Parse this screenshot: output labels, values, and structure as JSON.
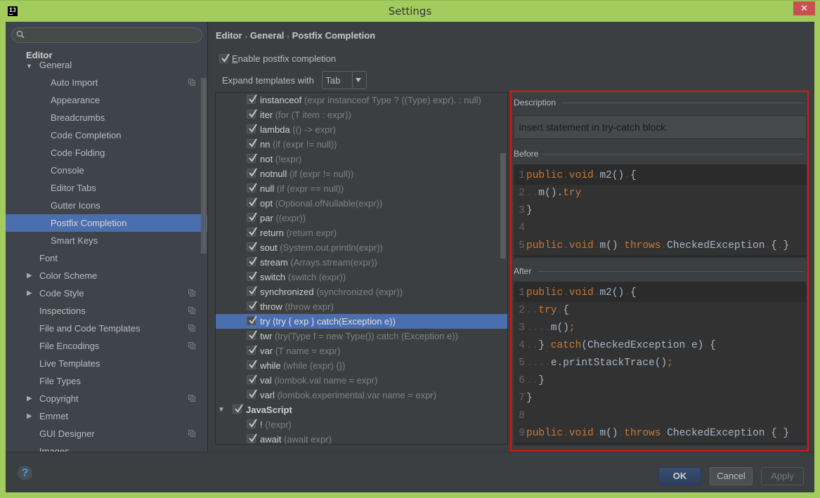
{
  "window": {
    "title": "Settings",
    "app_icon": "IJ",
    "close_glyph": "✕"
  },
  "sidebar": {
    "search_placeholder": "",
    "root": "Editor",
    "group": "General",
    "items": [
      {
        "label": "Auto Import",
        "level": 2,
        "project_icon": true
      },
      {
        "label": "Appearance",
        "level": 2
      },
      {
        "label": "Breadcrumbs",
        "level": 2
      },
      {
        "label": "Code Completion",
        "level": 2
      },
      {
        "label": "Code Folding",
        "level": 2
      },
      {
        "label": "Console",
        "level": 2
      },
      {
        "label": "Editor Tabs",
        "level": 2
      },
      {
        "label": "Gutter Icons",
        "level": 2
      },
      {
        "label": "Postfix Completion",
        "level": 2,
        "selected": true
      },
      {
        "label": "Smart Keys",
        "level": 2
      },
      {
        "label": "Font",
        "level": 1
      },
      {
        "label": "Color Scheme",
        "level": 1,
        "expandable": true
      },
      {
        "label": "Code Style",
        "level": 1,
        "expandable": true,
        "project_icon": true
      },
      {
        "label": "Inspections",
        "level": 1,
        "project_icon": true
      },
      {
        "label": "File and Code Templates",
        "level": 1,
        "project_icon": true
      },
      {
        "label": "File Encodings",
        "level": 1,
        "project_icon": true
      },
      {
        "label": "Live Templates",
        "level": 1
      },
      {
        "label": "File Types",
        "level": 1
      },
      {
        "label": "Copyright",
        "level": 1,
        "expandable": true,
        "project_icon": true
      },
      {
        "label": "Emmet",
        "level": 1,
        "expandable": true
      },
      {
        "label": "GUI Designer",
        "level": 1,
        "project_icon": true
      },
      {
        "label": "Images",
        "level": 1
      }
    ]
  },
  "content": {
    "breadcrumb": [
      "Editor",
      "General",
      "Postfix Completion"
    ],
    "breadcrumb_sep": "›",
    "enable_label_mnemonic": "E",
    "enable_label_rest": "nable postfix completion",
    "enable_checked": true,
    "expand_label": "Expand templates with",
    "expand_value": "Tab",
    "templates": [
      {
        "name": "instanceof",
        "desc": "(expr instanceof Type ? ((Type) expr). : null)",
        "checked": true
      },
      {
        "name": "iter",
        "desc": "(for (T item : expr))",
        "checked": true
      },
      {
        "name": "lambda",
        "desc": "(() -> expr)",
        "checked": true
      },
      {
        "name": "nn",
        "desc": "(if (expr != null))",
        "checked": true
      },
      {
        "name": "not",
        "desc": "(!expr)",
        "checked": true
      },
      {
        "name": "notnull",
        "desc": "(if (expr != null))",
        "checked": true
      },
      {
        "name": "null",
        "desc": "(if (expr == null))",
        "checked": true
      },
      {
        "name": "opt",
        "desc": "(Optional.ofNullable(expr))",
        "checked": true
      },
      {
        "name": "par",
        "desc": "((expr))",
        "checked": true
      },
      {
        "name": "return",
        "desc": "(return expr)",
        "checked": true
      },
      {
        "name": "sout",
        "desc": "(System.out.println(expr))",
        "checked": true
      },
      {
        "name": "stream",
        "desc": "(Arrays.stream(expr))",
        "checked": true
      },
      {
        "name": "switch",
        "desc": "(switch (expr))",
        "checked": true
      },
      {
        "name": "synchronized",
        "desc": "(synchronized (expr))",
        "checked": true
      },
      {
        "name": "throw",
        "desc": "(throw expr)",
        "checked": true
      },
      {
        "name": "try",
        "desc": "(try { exp } catch(Exception e))",
        "checked": true,
        "selected": true
      },
      {
        "name": "twr",
        "desc": "(try(Type f = new Type()) catch (Exception e))",
        "checked": true
      },
      {
        "name": "var",
        "desc": "(T name = expr)",
        "checked": true
      },
      {
        "name": "while",
        "desc": "(while (expr) {})",
        "checked": true
      },
      {
        "name": "val",
        "desc": "(lombok.val name = expr)",
        "checked": true
      },
      {
        "name": "varl",
        "desc": "(lombok.experimental.var name = expr)",
        "checked": true
      },
      {
        "name": "JavaScript",
        "desc": "",
        "checked": true,
        "group": true,
        "expanded": true
      },
      {
        "name": "!",
        "desc": "(!expr)",
        "checked": true
      },
      {
        "name": "await",
        "desc": "(await expr)",
        "checked": true
      }
    ]
  },
  "details": {
    "description_label": "Description",
    "description_text": "Insert statement in try-catch block.",
    "before_label": "Before",
    "after_label": "After",
    "before_code": [
      [
        [
          "kw",
          "public"
        ],
        [
          "dot",
          "."
        ],
        [
          "kw",
          "void"
        ],
        [
          "dot",
          "."
        ],
        [
          "id",
          "m2()"
        ],
        [
          "dot",
          "."
        ],
        [
          "id",
          "{"
        ]
      ],
      [
        [
          "dot",
          ".."
        ],
        [
          "id",
          "m()."
        ],
        [
          "kw",
          "try"
        ]
      ],
      [
        [
          "id",
          "}"
        ]
      ],
      [],
      [
        [
          "kw",
          "public"
        ],
        [
          "dot",
          "."
        ],
        [
          "kw",
          "void"
        ],
        [
          "dot",
          "."
        ],
        [
          "id",
          "m()"
        ],
        [
          "dot",
          "."
        ],
        [
          "kw",
          "throws"
        ],
        [
          "dot",
          "."
        ],
        [
          "id",
          "CheckedException"
        ],
        [
          "dot",
          "."
        ],
        [
          "id",
          "{"
        ],
        [
          "dot",
          "."
        ],
        [
          "id",
          "}"
        ]
      ]
    ],
    "after_code": [
      [
        [
          "kw",
          "public"
        ],
        [
          "dot",
          "."
        ],
        [
          "kw",
          "void"
        ],
        [
          "dot",
          "."
        ],
        [
          "id",
          "m2()"
        ],
        [
          "dot",
          "."
        ],
        [
          "id",
          "{"
        ]
      ],
      [
        [
          "dot",
          ".."
        ],
        [
          "kw",
          "try"
        ],
        [
          "dot",
          "."
        ],
        [
          "id",
          "{"
        ]
      ],
      [
        [
          "dot",
          "...."
        ],
        [
          "id",
          "m()"
        ],
        [
          "kw",
          ";"
        ]
      ],
      [
        [
          "dot",
          ".."
        ],
        [
          "id",
          "}"
        ],
        [
          "dot",
          "."
        ],
        [
          "kw",
          "catch"
        ],
        [
          "id",
          "(CheckedException"
        ],
        [
          "dot",
          "."
        ],
        [
          "id",
          "e)"
        ],
        [
          "dot",
          "."
        ],
        [
          "id",
          "{"
        ]
      ],
      [
        [
          "dot",
          "...."
        ],
        [
          "id",
          "e.printStackTrace()"
        ],
        [
          "kw",
          ";"
        ]
      ],
      [
        [
          "dot",
          ".."
        ],
        [
          "id",
          "}"
        ]
      ],
      [
        [
          "id",
          "}"
        ]
      ],
      [],
      [
        [
          "kw",
          "public"
        ],
        [
          "dot",
          "."
        ],
        [
          "kw",
          "void"
        ],
        [
          "dot",
          "."
        ],
        [
          "id",
          "m()"
        ],
        [
          "dot",
          "."
        ],
        [
          "kw",
          "throws"
        ],
        [
          "dot",
          "."
        ],
        [
          "id",
          "CheckedException"
        ],
        [
          "dot",
          "."
        ],
        [
          "id",
          "{"
        ],
        [
          "dot",
          "."
        ],
        [
          "id",
          "}"
        ]
      ]
    ]
  },
  "footer": {
    "help_label": "?",
    "ok_label": "OK",
    "cancel_label": "Cancel",
    "apply_label": "Apply",
    "apply_enabled": false
  },
  "colors": {
    "accent_selection": "#4b6eaf",
    "titlebar": "#a2cd5e",
    "close": "#c75050",
    "highlight_border": "#e81010",
    "keyword": "#cc7832",
    "identifier": "#a9b7c6"
  }
}
